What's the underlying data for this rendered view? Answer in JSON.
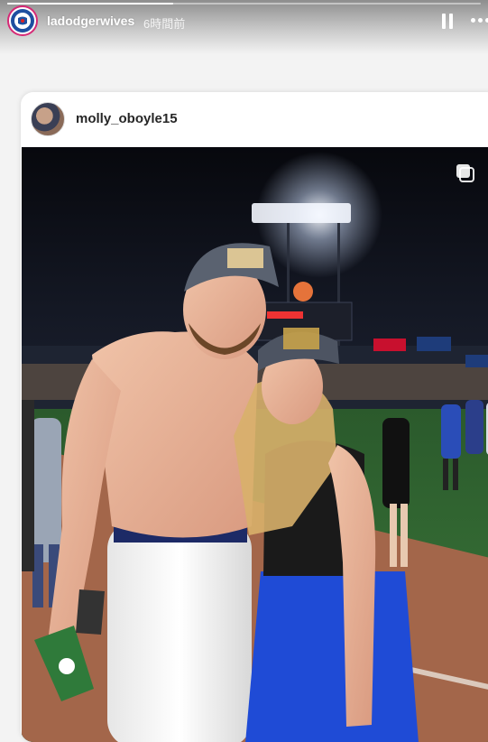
{
  "story": {
    "username": "ladodgerwives",
    "time_ago": "6時間前",
    "progress_fraction": 0.35,
    "avatar_icon": "dodgers-logo-icon",
    "pause_icon": "pause-icon",
    "more_icon": "more-options-icon"
  },
  "post": {
    "username": "molly_oboyle15",
    "avatar_icon": "profile-avatar",
    "multi_image_icon": "carousel-icon",
    "photo_alt": "photo"
  },
  "colors": {
    "field_green": "#2f6b33",
    "dirt": "#a3664a",
    "skirt_blue": "#1f4bd6",
    "night_sky": "#0b0d14"
  }
}
